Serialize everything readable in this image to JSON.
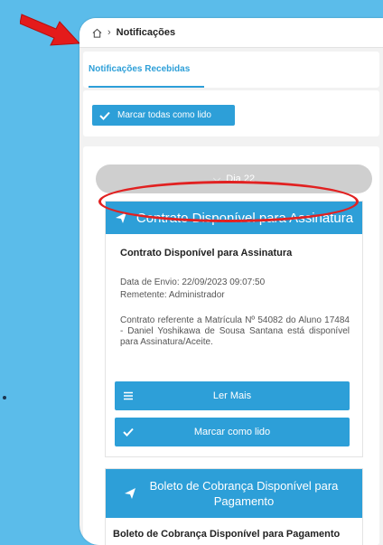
{
  "breadcrumb": {
    "current": "Notificações"
  },
  "tabs": [
    {
      "label": "Notificações Recebidas",
      "active": true
    }
  ],
  "mark_all": {
    "label": "Marcar todas como lido"
  },
  "day_group": {
    "label": "Dia 22"
  },
  "notifications": [
    {
      "header": "Contrato Disponível para Assinatura",
      "subtitle": "Contrato Disponível para Assinatura",
      "date": "Data de Envio: 22/09/2023 09:07:50",
      "sender": "Remetente: Administrador",
      "text": "Contrato referente a Matrícula Nº 54082 do Aluno 17484 - Daniel Yoshikawa de Sousa Santana está disponível para Assinatura/Aceite.",
      "read_more": "Ler Mais",
      "mark_read": "Marcar como lido"
    },
    {
      "header": "Boleto de Cobrança Disponível para Pagamento",
      "subtitle": "Boleto de Cobrança Disponível para Pagamento"
    }
  ],
  "colors": {
    "accent": "#2d9fd8",
    "background": "#5bbcea",
    "highlight": "#e12121"
  },
  "icons": [
    "home-icon",
    "chevron-right-icon",
    "check-icon",
    "chevron-down-icon",
    "paper-plane-icon",
    "menu-icon"
  ]
}
